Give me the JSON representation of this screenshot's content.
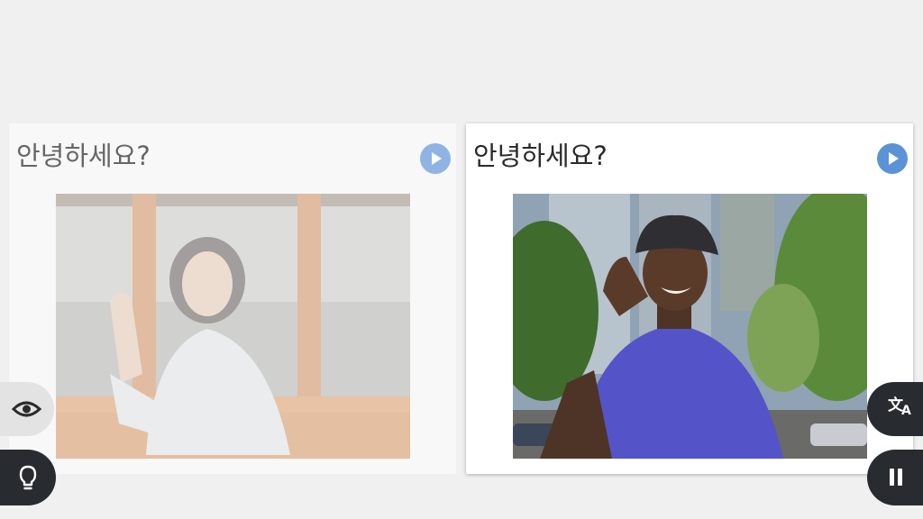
{
  "cards": [
    {
      "prompt": "안녕하세요?",
      "state": "dimmed",
      "play_icon": "play-icon",
      "photo": "woman waving from window"
    },
    {
      "prompt": "안녕하세요?",
      "state": "selected",
      "play_icon": "play-icon",
      "photo": "man tipping hat"
    }
  ],
  "controls": {
    "left": [
      {
        "icon": "eye-icon"
      },
      {
        "icon": "lightbulb-icon"
      }
    ],
    "right": [
      {
        "icon": "translate-icon",
        "glyph_primary": "文",
        "glyph_secondary": "A"
      },
      {
        "icon": "pause-icon"
      }
    ]
  },
  "colors": {
    "background": "#f0f0f0",
    "play_button": "#5b93d6",
    "dark_button": "#282b30",
    "light_button": "#e3e3e3"
  }
}
